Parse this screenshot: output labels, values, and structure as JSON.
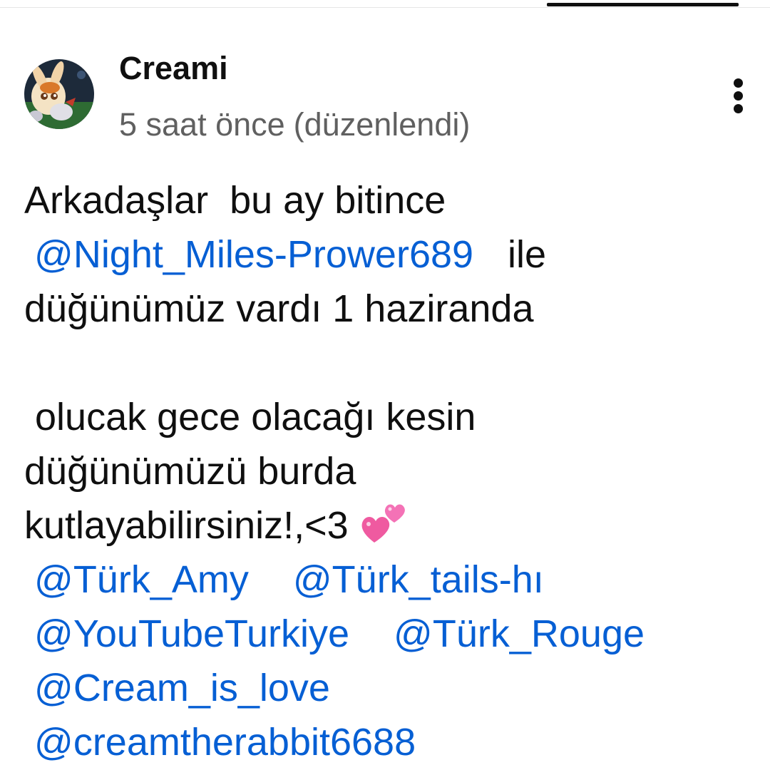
{
  "author": {
    "name": "Creami"
  },
  "meta": {
    "time_ago": "5 saat önce",
    "edited": "(düzenlendi)"
  },
  "comment": {
    "line1": "Arkadaşlar  bu ay bitince",
    "mention_night_miles": "@Night_Miles-Prower689",
    "line2_suffix": "ile",
    "line3": "düğünümüz vardı 1 haziranda",
    "line5": " olucak gece olacağı kesin",
    "line6": "düğünümüzü burda",
    "line7": "kutlayabilirsiniz!,<3",
    "emoji": "revolving-hearts-icon",
    "mentions": {
      "turk_amy": "@Türk_Amy",
      "turk_tails": "@Türk_tails-hı",
      "youtube_turkiye": "@YouTubeTurkiye",
      "turk_rouge": "@Türk_Rouge",
      "cream_is_love": "@Cream_is_love",
      "creamtherabbit": "@creamtherabbit6688"
    }
  },
  "colors": {
    "mention": "#065fd4",
    "secondary_text": "#606060",
    "primary_text": "#0f0f0f",
    "heart": "#ef5aa0"
  }
}
